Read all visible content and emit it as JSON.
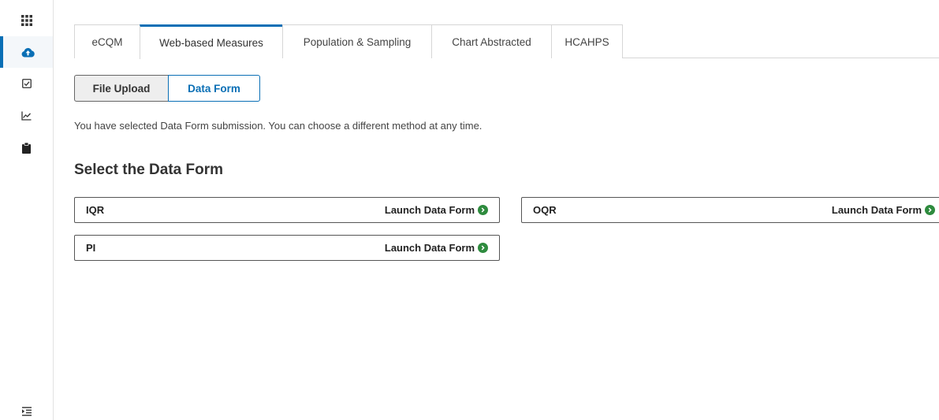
{
  "rail": {
    "items": [
      {
        "icon": "grid-icon"
      },
      {
        "icon": "cloud-upload-icon",
        "active": true
      },
      {
        "icon": "checkbox-icon"
      },
      {
        "icon": "line-chart-icon"
      },
      {
        "icon": "clipboard-icon"
      }
    ],
    "bottom_icon": "expand-menu-icon"
  },
  "tabs": [
    {
      "label": "eCQM"
    },
    {
      "label": "Web-based Measures",
      "active": true
    },
    {
      "label": "Population & Sampling"
    },
    {
      "label": "Chart Abstracted"
    },
    {
      "label": "HCAHPS"
    }
  ],
  "method_toggle": {
    "file_upload": "File Upload",
    "data_form": "Data Form",
    "selected": "Data Form"
  },
  "notice": "You have selected Data Form submission. You can choose a different method at any time.",
  "section_title": "Select the Data Form",
  "forms": [
    {
      "name": "IQR",
      "action": "Launch Data Form"
    },
    {
      "name": "OQR",
      "action": "Launch Data Form"
    },
    {
      "name": "PI",
      "action": "Launch Data Form"
    }
  ],
  "colors": {
    "accent": "#0a6fb5",
    "launch_icon": "#2e8b3e"
  }
}
